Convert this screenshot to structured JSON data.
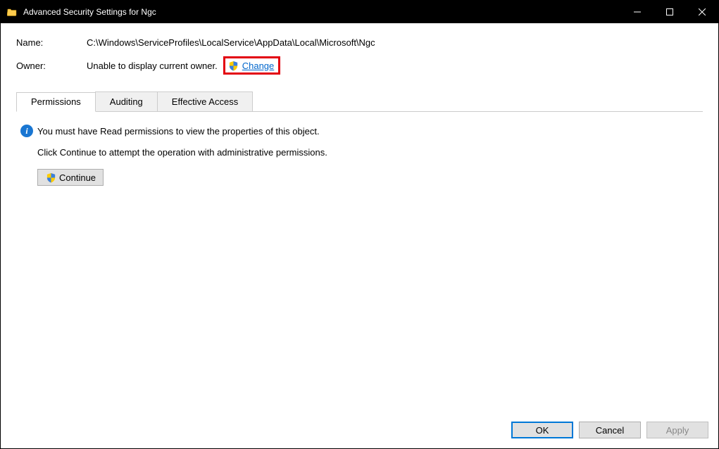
{
  "titlebar": {
    "title": "Advanced Security Settings for Ngc"
  },
  "fields": {
    "name_label": "Name:",
    "name_value": "C:\\Windows\\ServiceProfiles\\LocalService\\AppData\\Local\\Microsoft\\Ngc",
    "owner_label": "Owner:",
    "owner_value": "Unable to display current owner.",
    "change_link": "Change"
  },
  "tabs": {
    "permissions": "Permissions",
    "auditing": "Auditing",
    "effective": "Effective Access"
  },
  "body": {
    "info_text": "You must have Read permissions to view the properties of this object.",
    "instruction": "Click Continue to attempt the operation with administrative permissions.",
    "continue_btn": "Continue"
  },
  "footer": {
    "ok": "OK",
    "cancel": "Cancel",
    "apply": "Apply"
  }
}
